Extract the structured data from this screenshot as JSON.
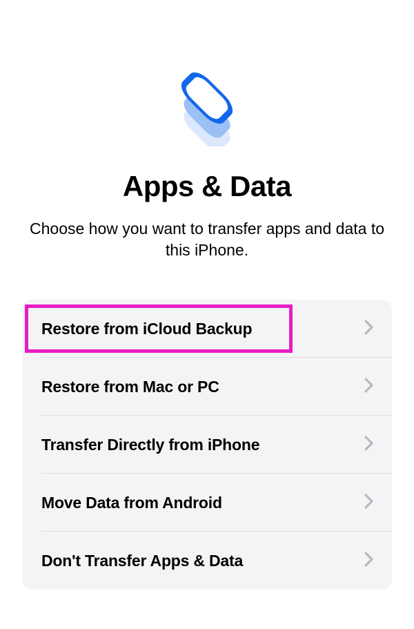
{
  "iconName": "stacked-squares-icon",
  "title": "Apps & Data",
  "subtitle": "Choose how you want to transfer apps and data to this iPhone.",
  "options": [
    {
      "label": "Restore from iCloud Backup",
      "highlighted": true
    },
    {
      "label": "Restore from Mac or PC",
      "highlighted": false
    },
    {
      "label": "Transfer Directly from iPhone",
      "highlighted": false
    },
    {
      "label": "Move Data from Android",
      "highlighted": false
    },
    {
      "label": "Don't Transfer Apps & Data",
      "highlighted": false
    }
  ],
  "colors": {
    "accent": "#1268ea",
    "highlight": "#e81cc7",
    "cardBg": "#f4f4f6",
    "divider": "#dddde0"
  }
}
